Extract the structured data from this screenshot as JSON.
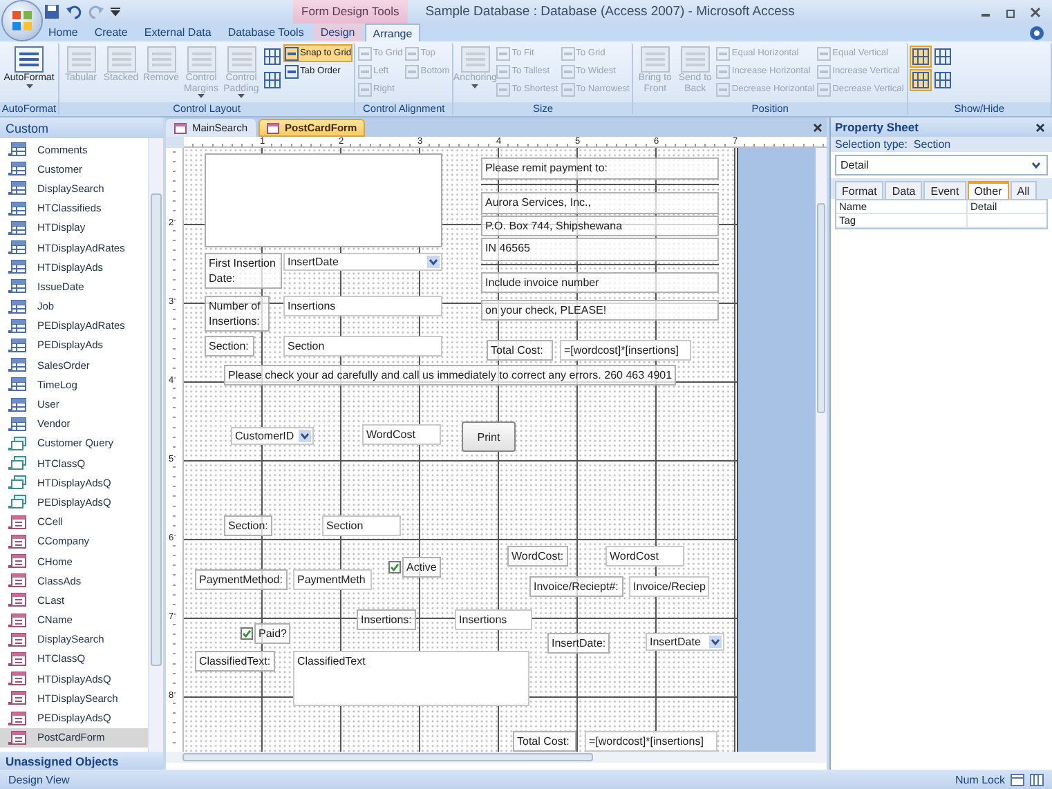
{
  "titlebar": {
    "context_header": "Form Design Tools",
    "title": "Sample Database : Database (Access 2007) - Microsoft Access"
  },
  "ribbon": {
    "tabs": [
      {
        "label": "Home",
        "selected": false,
        "contextual": false
      },
      {
        "label": "Create",
        "selected": false,
        "contextual": false
      },
      {
        "label": "External Data",
        "selected": false,
        "contextual": false
      },
      {
        "label": "Database Tools",
        "selected": false,
        "contextual": false
      },
      {
        "label": "Design",
        "selected": false,
        "contextual": true
      },
      {
        "label": "Arrange",
        "selected": true,
        "contextual": true
      }
    ],
    "groups": [
      {
        "label": "AutoFormat",
        "columns": [
          [
            {
              "label": "AutoFormat",
              "kind": "large",
              "dropdown": true,
              "disabled": false,
              "on": false
            }
          ]
        ]
      },
      {
        "label": "Control Layout",
        "columns": [
          [
            {
              "label": "Tabular",
              "kind": "large",
              "dropdown": false,
              "disabled": true,
              "on": false
            }
          ],
          [
            {
              "label": "Stacked",
              "kind": "large",
              "dropdown": false,
              "disabled": true,
              "on": false
            }
          ],
          [
            {
              "label": "Remove",
              "kind": "large",
              "dropdown": false,
              "disabled": true,
              "on": false
            }
          ],
          [
            {
              "label": "Control Margins",
              "kind": "large",
              "dropdown": true,
              "disabled": true,
              "on": false
            }
          ],
          [
            {
              "label": "Control Padding",
              "kind": "large",
              "dropdown": true,
              "disabled": true,
              "on": false
            }
          ],
          [
            {
              "kind": "icon",
              "disabled": false,
              "on": false
            },
            {
              "kind": "icon",
              "disabled": false,
              "on": false
            }
          ],
          [
            {
              "label": "Snap to Grid",
              "kind": "small",
              "disabled": false,
              "on": true
            },
            {
              "label": "Tab Order",
              "kind": "small",
              "disabled": false,
              "on": false
            }
          ]
        ]
      },
      {
        "label": "Control Alignment",
        "columns": [
          [
            {
              "label": "To Grid",
              "kind": "small",
              "disabled": true,
              "on": false
            },
            {
              "label": "Left",
              "kind": "small",
              "disabled": true,
              "on": false
            },
            {
              "label": "Right",
              "kind": "small",
              "disabled": true,
              "on": false
            }
          ],
          [
            {
              "label": "Top",
              "kind": "small",
              "disabled": true,
              "on": false
            },
            {
              "label": "Bottom",
              "kind": "small",
              "disabled": true,
              "on": false
            }
          ]
        ]
      },
      {
        "label": "Size",
        "columns": [
          [
            {
              "label": "Anchoring",
              "kind": "large",
              "dropdown": true,
              "disabled": true,
              "on": false
            }
          ],
          [
            {
              "label": "To Fit",
              "kind": "small",
              "disabled": true,
              "on": false
            },
            {
              "label": "To Tallest",
              "kind": "small",
              "disabled": true,
              "on": false
            },
            {
              "label": "To Shortest",
              "kind": "small",
              "disabled": true,
              "on": false
            }
          ],
          [
            {
              "label": "To Grid",
              "kind": "small",
              "disabled": true,
              "on": false
            },
            {
              "label": "To Widest",
              "kind": "small",
              "disabled": true,
              "on": false
            },
            {
              "label": "To Narrowest",
              "kind": "small",
              "disabled": true,
              "on": false
            }
          ]
        ]
      },
      {
        "label": "Position",
        "columns": [
          [
            {
              "label": "Bring to Front",
              "kind": "large",
              "dropdown": false,
              "disabled": true,
              "on": false
            }
          ],
          [
            {
              "label": "Send to Back",
              "kind": "large",
              "dropdown": false,
              "disabled": true,
              "on": false
            }
          ],
          [
            {
              "label": "Equal Horizontal",
              "kind": "small",
              "disabled": true,
              "on": false
            },
            {
              "label": "Increase Horizontal",
              "kind": "small",
              "disabled": true,
              "on": false
            },
            {
              "label": "Decrease Horizontal",
              "kind": "small",
              "disabled": true,
              "on": false
            }
          ],
          [
            {
              "label": "Equal Vertical",
              "kind": "small",
              "disabled": true,
              "on": false
            },
            {
              "label": "Increase Vertical",
              "kind": "small",
              "disabled": true,
              "on": false
            },
            {
              "label": "Decrease Vertical",
              "kind": "small",
              "disabled": true,
              "on": false
            }
          ]
        ]
      },
      {
        "label": "Show/Hide",
        "columns": [
          [
            {
              "kind": "icon",
              "disabled": false,
              "on": true
            },
            {
              "kind": "icon",
              "disabled": false,
              "on": true
            }
          ],
          [
            {
              "kind": "icon",
              "disabled": false,
              "on": false
            },
            {
              "kind": "icon",
              "disabled": false,
              "on": false
            }
          ]
        ]
      }
    ]
  },
  "navigation": {
    "header": "Custom",
    "items": [
      {
        "label": "Comments",
        "kind": "table",
        "selected": false
      },
      {
        "label": "Customer",
        "kind": "table",
        "selected": false
      },
      {
        "label": "DisplaySearch",
        "kind": "table",
        "selected": false
      },
      {
        "label": "HTClassifieds",
        "kind": "table",
        "selected": false
      },
      {
        "label": "HTDisplay",
        "kind": "table",
        "selected": false
      },
      {
        "label": "HTDisplayAdRates",
        "kind": "table",
        "selected": false
      },
      {
        "label": "HTDisplayAds",
        "kind": "table",
        "selected": false
      },
      {
        "label": "IssueDate",
        "kind": "table",
        "selected": false
      },
      {
        "label": "Job",
        "kind": "table",
        "selected": false
      },
      {
        "label": "PEDisplayAdRates",
        "kind": "table",
        "selected": false
      },
      {
        "label": "PEDisplayAds",
        "kind": "table",
        "selected": false
      },
      {
        "label": "SalesOrder",
        "kind": "table",
        "selected": false
      },
      {
        "label": "TimeLog",
        "kind": "table",
        "selected": false
      },
      {
        "label": "User",
        "kind": "table",
        "selected": false
      },
      {
        "label": "Vendor",
        "kind": "table",
        "selected": false
      },
      {
        "label": "Customer Query",
        "kind": "query",
        "selected": false
      },
      {
        "label": "HTClassQ",
        "kind": "query",
        "selected": false
      },
      {
        "label": "HTDisplayAdsQ",
        "kind": "query",
        "selected": false
      },
      {
        "label": "PEDisplayAdsQ",
        "kind": "query",
        "selected": false
      },
      {
        "label": "CCell",
        "kind": "form",
        "selected": false
      },
      {
        "label": "CCompany",
        "kind": "form",
        "selected": false
      },
      {
        "label": "CHome",
        "kind": "form",
        "selected": false
      },
      {
        "label": "ClassAds",
        "kind": "form",
        "selected": false
      },
      {
        "label": "CLast",
        "kind": "form",
        "selected": false
      },
      {
        "label": "CName",
        "kind": "form",
        "selected": false
      },
      {
        "label": "DisplaySearch",
        "kind": "form",
        "selected": false
      },
      {
        "label": "HTClassQ",
        "kind": "form",
        "selected": false
      },
      {
        "label": "HTDisplayAdsQ",
        "kind": "form",
        "selected": false
      },
      {
        "label": "HTDisplaySearch",
        "kind": "form",
        "selected": false
      },
      {
        "label": "PEDisplayAdsQ",
        "kind": "form",
        "selected": false
      },
      {
        "label": "PostCardForm",
        "kind": "form",
        "selected": true
      }
    ],
    "footer": "Unassigned Objects"
  },
  "document": {
    "tabs": [
      {
        "label": "MainSearch",
        "selected": false
      },
      {
        "label": "PostCardForm",
        "selected": true
      }
    ],
    "rulers": {
      "horizontal": [
        "1",
        "2",
        "3",
        "4",
        "5",
        "6",
        "7"
      ],
      "vertical": [
        "2",
        "3",
        "4",
        "5",
        "6",
        "7",
        "8"
      ]
    },
    "controls": [
      {
        "kind": "frame"
      },
      {
        "kind": "label",
        "text": "Please remit payment to:"
      },
      {
        "kind": "line"
      },
      {
        "kind": "label",
        "text": "Aurora Services, Inc.,"
      },
      {
        "kind": "label",
        "text": "P.O. Box 744, Shipshewana"
      },
      {
        "kind": "label",
        "text": "IN 46565"
      },
      {
        "kind": "line"
      },
      {
        "kind": "label",
        "text": "Include invoice number"
      },
      {
        "kind": "label",
        "text": "on your check, PLEASE!"
      },
      {
        "kind": "label",
        "text": "First Insertion Date:"
      },
      {
        "kind": "combo",
        "text": "InsertDate"
      },
      {
        "kind": "label",
        "text": "Number of Insertions:"
      },
      {
        "kind": "textbox",
        "text": "Insertions"
      },
      {
        "kind": "label",
        "text": "Section:"
      },
      {
        "kind": "textbox",
        "text": "Section"
      },
      {
        "kind": "label",
        "text": "Total Cost:"
      },
      {
        "kind": "textbox",
        "text": "=[wordcost]*[insertions]"
      },
      {
        "kind": "label",
        "text": "Please check your ad carefully and call us immediately to correct any errors. 260 463 4901"
      },
      {
        "kind": "combo",
        "text": "CustomerID"
      },
      {
        "kind": "textbox",
        "text": "WordCost"
      },
      {
        "kind": "button",
        "text": "Print"
      },
      {
        "kind": "label",
        "text": "Section:"
      },
      {
        "kind": "textbox",
        "text": "Section"
      },
      {
        "kind": "label",
        "text": "WordCost:"
      },
      {
        "kind": "textbox",
        "text": "WordCost"
      },
      {
        "kind": "checkbox",
        "text": "Active",
        "checked": true
      },
      {
        "kind": "label",
        "text": "PaymentMethod:"
      },
      {
        "kind": "textbox",
        "text": "PaymentMeth"
      },
      {
        "kind": "label",
        "text": "Invoice/Reciept#:"
      },
      {
        "kind": "textbox",
        "text": "Invoice/Reciep"
      },
      {
        "kind": "label",
        "text": "Insertions:"
      },
      {
        "kind": "textbox",
        "text": "Insertions"
      },
      {
        "kind": "checkbox",
        "text": "Paid?",
        "checked": true
      },
      {
        "kind": "label",
        "text": "InsertDate:"
      },
      {
        "kind": "combo",
        "text": "InsertDate"
      },
      {
        "kind": "label",
        "text": "ClassifiedText:"
      },
      {
        "kind": "textbox",
        "text": "ClassifiedText"
      },
      {
        "kind": "label",
        "text": "Total Cost:"
      },
      {
        "kind": "textbox",
        "text": "=[wordcost]*[insertions]"
      }
    ]
  },
  "property_sheet": {
    "title": "Property Sheet",
    "selection_type": "Selection type:  Section",
    "object": "Detail",
    "tabs": [
      {
        "label": "Format",
        "selected": false
      },
      {
        "label": "Data",
        "selected": false
      },
      {
        "label": "Event",
        "selected": false
      },
      {
        "label": "Other",
        "selected": true
      },
      {
        "label": "All",
        "selected": false
      }
    ],
    "rows": [
      {
        "name": "Name",
        "value": "Detail"
      },
      {
        "name": "Tag"
      }
    ]
  },
  "status_bar": {
    "left": "Design View",
    "right": "Num Lock"
  }
}
